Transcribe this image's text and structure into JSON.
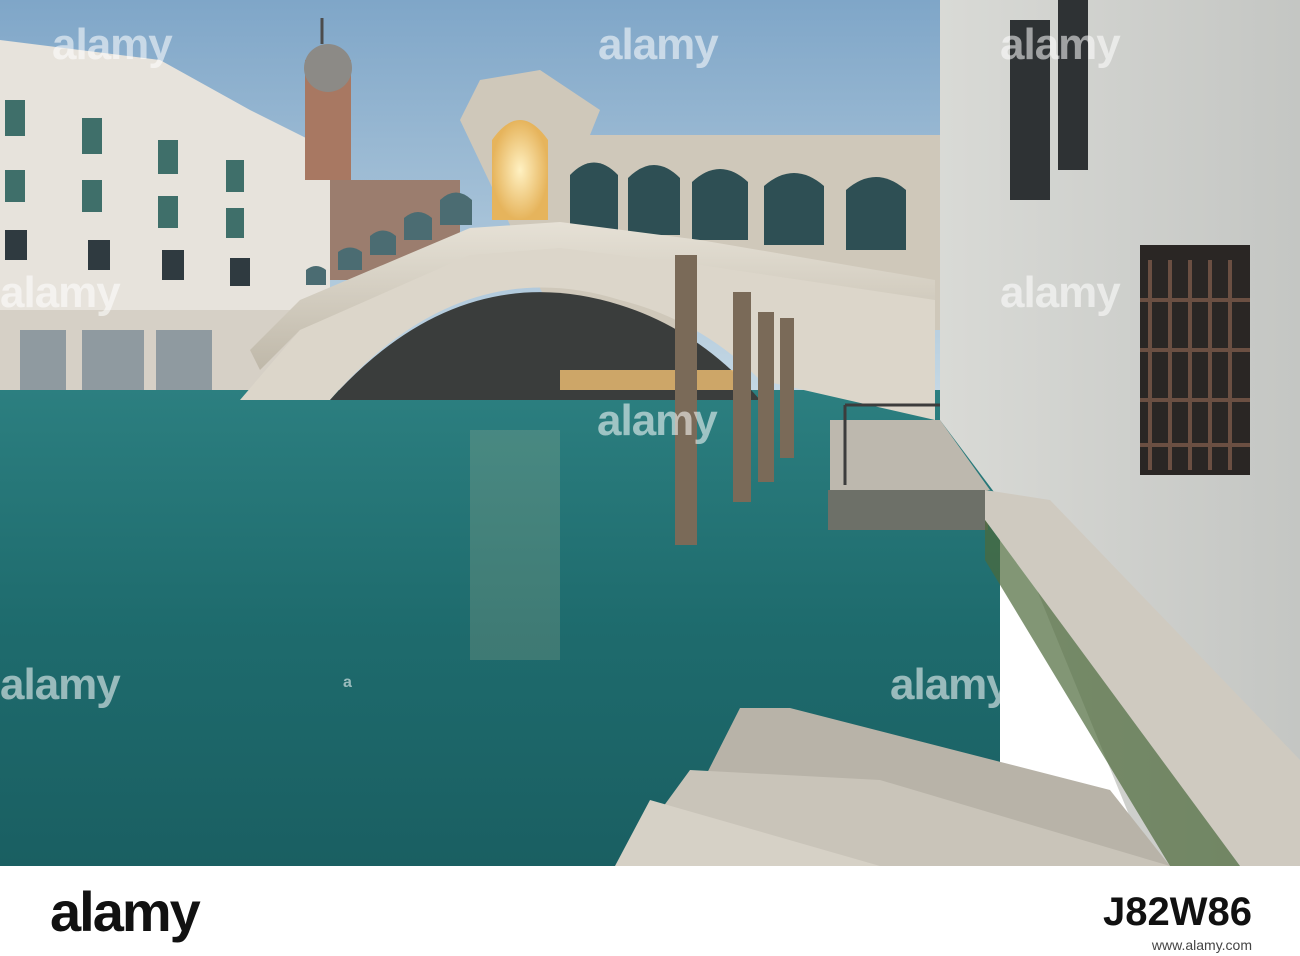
{
  "photo": {
    "subject": "Rialto Bridge over the Grand Canal, Venice, at dusk",
    "colors": {
      "sky": "#a7c6dd",
      "water": "#1f6f70",
      "stone": "#d8d3c8",
      "lamp": "#f6d48a"
    }
  },
  "watermarks": [
    {
      "text": "alamy",
      "badge": "a"
    },
    {
      "text": "alamy",
      "badge": "a"
    },
    {
      "text": "alamy",
      "badge": "a"
    },
    {
      "text": "alamy",
      "badge": "a"
    },
    {
      "text": "alamy",
      "badge": "a"
    },
    {
      "text": "alamy",
      "badge": "a"
    },
    {
      "text": "alamy",
      "badge": "a"
    },
    {
      "text": "alamy",
      "badge": "a"
    },
    {
      "text": "alamy",
      "badge": "a"
    }
  ],
  "footer": {
    "logo": "alamy",
    "image_id": "J82W86",
    "url": "www.alamy.com"
  }
}
